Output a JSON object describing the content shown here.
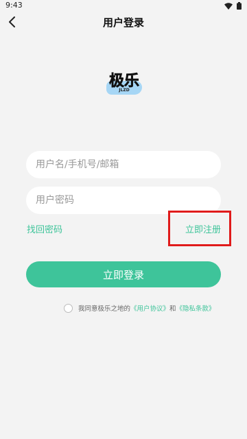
{
  "status": {
    "time": "9:43"
  },
  "header": {
    "title": "用户登录"
  },
  "logo": {
    "text": "极乐",
    "sub": "JLZD"
  },
  "form": {
    "account_placeholder": "用户名/手机号/邮箱",
    "password_placeholder": "用户密码",
    "forgot_label": "找回密码",
    "register_label": "立即注册",
    "login_label": "立即登录"
  },
  "agreement": {
    "prefix": "我同意极乐之地的",
    "user_agreement": "《用户协议》",
    "and": "和",
    "privacy_policy": "《隐私条款》"
  },
  "colors": {
    "accent": "#3ec49a",
    "highlight": "#e01b1b"
  },
  "icons": {
    "back": "chevron-left-icon",
    "wifi": "wifi-icon",
    "battery": "battery-icon"
  }
}
